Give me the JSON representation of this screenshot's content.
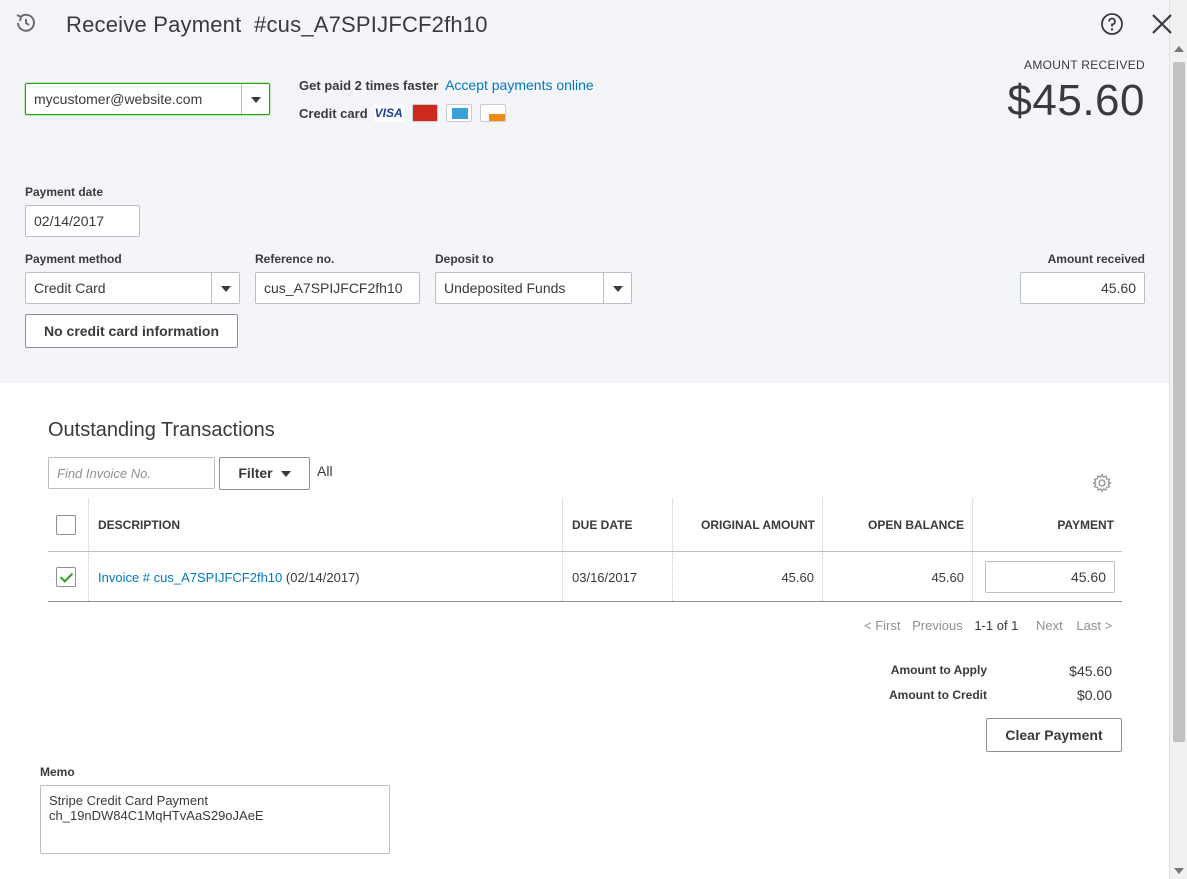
{
  "header": {
    "title": "Receive Payment",
    "reference_id": "#cus_A7SPIJFCF2fh10",
    "history_icon": "history-clock-icon",
    "help_icon": "question-circle-icon",
    "close_icon": "close-x-icon"
  },
  "customer": {
    "value": "mycustomer@website.com"
  },
  "promo": {
    "get_paid": "Get paid 2 times faster",
    "accept_link": "Accept payments online",
    "credit_card_label": "Credit card",
    "cards": [
      "VISA",
      "MasterCard",
      "American Express",
      "DISCOVER"
    ]
  },
  "amount_received_header": {
    "label": "AMOUNT RECEIVED",
    "value": "$45.60"
  },
  "form": {
    "payment_date_label": "Payment date",
    "payment_date": "02/14/2017",
    "payment_method_label": "Payment method",
    "payment_method": "Credit Card",
    "reference_label": "Reference no.",
    "reference_value": "cus_A7SPIJFCF2fh10",
    "deposit_label": "Deposit to",
    "deposit_value": "Undeposited Funds",
    "amount_label": "Amount received",
    "amount_value": "45.60",
    "no_card_button": "No credit card information"
  },
  "outstanding": {
    "title": "Outstanding Transactions",
    "find_placeholder": "Find Invoice No.",
    "filter_label": "Filter",
    "filter_state": "All",
    "settings_icon": "gear-icon",
    "columns": {
      "description": "DESCRIPTION",
      "due_date": "DUE DATE",
      "original_amount": "ORIGINAL AMOUNT",
      "open_balance": "OPEN BALANCE",
      "payment": "PAYMENT"
    },
    "rows": [
      {
        "checked": true,
        "invoice_link": "Invoice # cus_A7SPIJFCF2fh10",
        "invoice_date": "(02/14/2017)",
        "due_date": "03/16/2017",
        "original_amount": "45.60",
        "open_balance": "45.60",
        "payment": "45.60"
      }
    ],
    "pager": {
      "first": "< First",
      "previous": "Previous",
      "range": "1-1 of 1",
      "next": "Next",
      "last": "Last >"
    }
  },
  "summary": {
    "apply_label": "Amount to Apply",
    "apply_value": "$45.60",
    "credit_label": "Amount to Credit",
    "credit_value": "$0.00",
    "clear_button": "Clear Payment"
  },
  "memo": {
    "label": "Memo",
    "value": "Stripe Credit Card Payment\nch_19nDW84C1MqHTvAaS29oJAeE"
  },
  "colors": {
    "link": "#0077c5",
    "check_green": "#2ca01c",
    "header_bg": "#f4f5f8",
    "text": "#393a3d"
  }
}
